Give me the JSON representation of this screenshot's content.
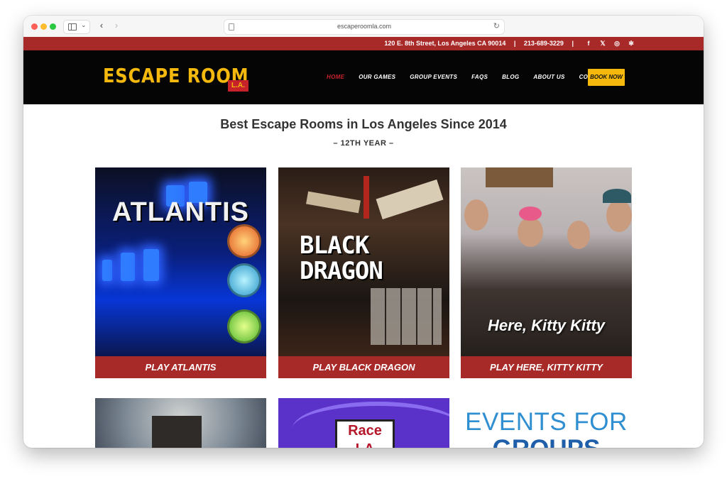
{
  "browser": {
    "url": "escaperoomla.com"
  },
  "topbar": {
    "address": "120 E. 8th Street, Los Angeles CA 90014",
    "phone": "213-689-3229",
    "separator": "|",
    "socials": [
      {
        "icon": "facebook-icon",
        "glyph": "f"
      },
      {
        "icon": "x-icon",
        "glyph": "𝕏"
      },
      {
        "icon": "instagram-icon",
        "glyph": "◎"
      },
      {
        "icon": "yelp-icon",
        "glyph": "✻"
      }
    ]
  },
  "header": {
    "logo_text": "ESCAPE ROOM",
    "logo_badge": "L.A.",
    "nav": [
      "HOME",
      "OUR GAMES",
      "GROUP EVENTS",
      "FAQS",
      "BLOG",
      "ABOUT US",
      "CONTACT"
    ],
    "active_nav": "HOME",
    "cta": "BOOK NOW"
  },
  "main": {
    "headline": "Best Escape Rooms in Los Angeles Since 2014",
    "subline": "– 12TH YEAR –",
    "cards": [
      {
        "image_text": "ATLANTIS",
        "button": "PLAY ATLANTIS"
      },
      {
        "image_text_1": "BLACK",
        "image_text_2": "DRAGON",
        "button": "PLAY BLACK DRAGON"
      },
      {
        "image_text": "Here, Kitty Kitty",
        "button": "PLAY HERE, KITTY KITTY"
      }
    ],
    "row2": [
      {
        "text": ""
      },
      {
        "text": "Race LA"
      },
      {
        "text_1": "EVENTS FOR",
        "text_2": "GROUPS"
      }
    ]
  },
  "colors": {
    "brand_red": "#a82a28",
    "brand_yellow": "#f5b90e",
    "header_bg": "#050505"
  }
}
